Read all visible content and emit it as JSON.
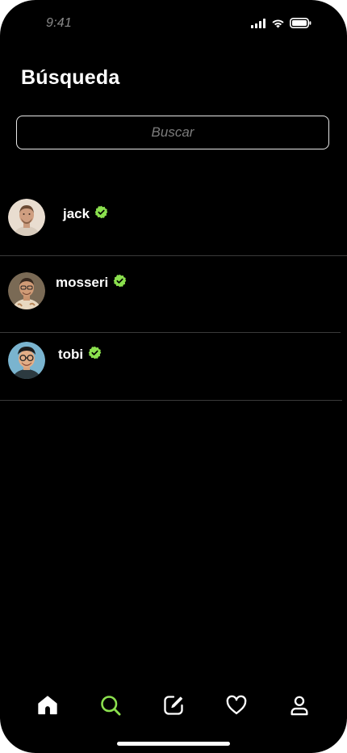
{
  "status": {
    "time": "9:41",
    "icons": [
      "cellular-signal-icon",
      "wifi-icon",
      "battery-icon"
    ]
  },
  "page": {
    "title": "Búsqueda"
  },
  "search": {
    "placeholder": "Buscar",
    "value": ""
  },
  "users": [
    {
      "username": "jack",
      "verified": true,
      "avatar": "avatar-jack"
    },
    {
      "username": "mosseri",
      "verified": true,
      "avatar": "avatar-mosseri"
    },
    {
      "username": "tobi",
      "verified": true,
      "avatar": "avatar-tobi"
    }
  ],
  "tabs": [
    {
      "icon": "home-icon",
      "active": false
    },
    {
      "icon": "search-icon",
      "active": true
    },
    {
      "icon": "compose-icon",
      "active": false
    },
    {
      "icon": "heart-icon",
      "active": false
    },
    {
      "icon": "profile-icon",
      "active": false
    }
  ],
  "colors": {
    "background": "#000000",
    "text": "#ffffff",
    "accent": "#8be04e",
    "verified": "#8be04e",
    "divider": "#3a3a3a",
    "muted": "#7c7c7c"
  }
}
